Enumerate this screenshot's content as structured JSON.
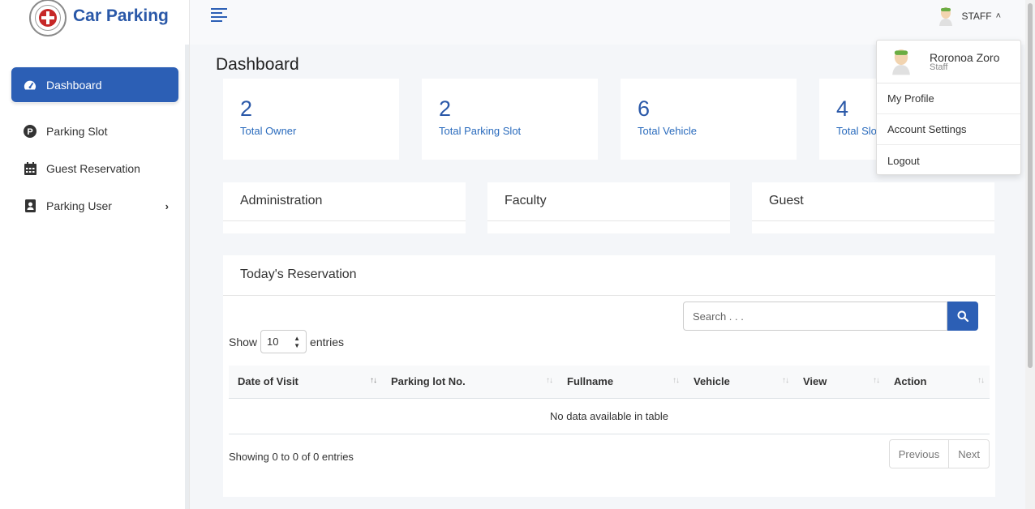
{
  "brand": {
    "title": "Car Parking"
  },
  "sidebar": {
    "items": [
      {
        "label": "Dashboard",
        "icon": "tachometer-icon",
        "active": true
      },
      {
        "label": "Parking Slot",
        "icon": "parking-icon"
      },
      {
        "label": "Guest Reservation",
        "icon": "calendar-icon"
      },
      {
        "label": "Parking User",
        "icon": "user-badge-icon",
        "has_children": true
      }
    ]
  },
  "topbar": {
    "user_label": "STAFF"
  },
  "user_menu": {
    "name": "Roronoa Zoro",
    "role": "Staff",
    "items": [
      "My Profile",
      "Account Settings",
      "Logout"
    ]
  },
  "page": {
    "title": "Dashboard"
  },
  "stats": [
    {
      "value": "2",
      "label": "Total Owner"
    },
    {
      "value": "2",
      "label": "Total Parking Slot"
    },
    {
      "value": "6",
      "label": "Total Vehicle"
    },
    {
      "value": "4",
      "label": "Total Slot"
    }
  ],
  "panels": [
    "Administration",
    "Faculty",
    "Guest"
  ],
  "reservation": {
    "title": "Today's Reservation",
    "search_placeholder": "Search . . .",
    "show_label": "Show",
    "entries_value": "10",
    "entries_label": "entries",
    "columns": [
      "Date of Visit",
      "Parking lot No.",
      "Fullname",
      "Vehicle",
      "View",
      "Action"
    ],
    "empty_text": "No data available in table",
    "info": "Showing 0 to 0 of 0 entries",
    "prev": "Previous",
    "next": "Next"
  },
  "colors": {
    "accent": "#2c5fb5",
    "brand": "#2a58a8"
  }
}
